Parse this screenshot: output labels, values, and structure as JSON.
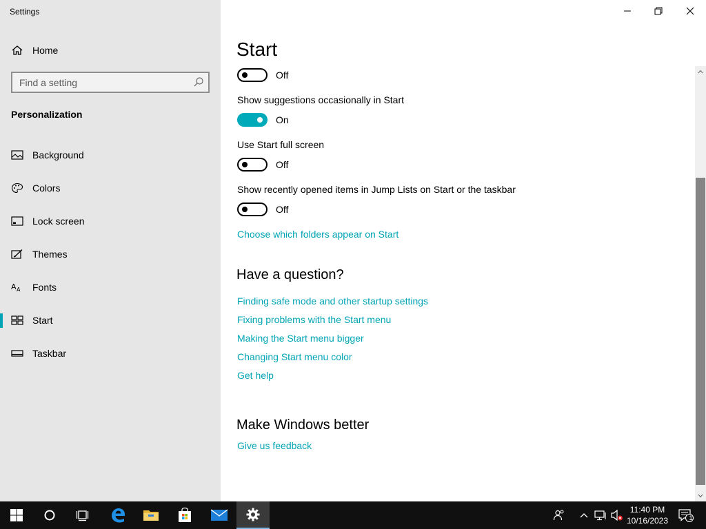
{
  "window": {
    "app_title": "Settings"
  },
  "sidebar": {
    "home_label": "Home",
    "search_placeholder": "Find a setting",
    "section_label": "Personalization",
    "items": [
      {
        "label": "Background",
        "icon": "picture-icon"
      },
      {
        "label": "Colors",
        "icon": "palette-icon"
      },
      {
        "label": "Lock screen",
        "icon": "lock-screen-icon"
      },
      {
        "label": "Themes",
        "icon": "themes-icon"
      },
      {
        "label": "Fonts",
        "icon": "fonts-icon"
      },
      {
        "label": "Start",
        "icon": "start-icon",
        "active": true
      },
      {
        "label": "Taskbar",
        "icon": "taskbar-icon"
      }
    ]
  },
  "main": {
    "title": "Start",
    "toggles": [
      {
        "label": "",
        "state": "Off",
        "on": false
      },
      {
        "label": "Show suggestions occasionally in Start",
        "state": "On",
        "on": true
      },
      {
        "label": "Use Start full screen",
        "state": "Off",
        "on": false
      },
      {
        "label": "Show recently opened items in Jump Lists on Start or the taskbar",
        "state": "Off",
        "on": false
      }
    ],
    "folders_link": "Choose which folders appear on Start",
    "question_heading": "Have a question?",
    "help_links": [
      "Finding safe mode and other startup settings",
      "Fixing problems with the Start menu",
      "Making the Start menu bigger",
      "Changing Start menu color",
      "Get help"
    ],
    "better_heading": "Make Windows better",
    "feedback_link": "Give us feedback"
  },
  "taskbar": {
    "time": "11:40 PM",
    "date": "10/16/2023",
    "notification_count": "1"
  },
  "colors": {
    "accent": "#00a4b4",
    "toggle_on": "#00aab9",
    "sidebar_bg": "#e6e6e6",
    "taskbar_bg": "#101010"
  }
}
